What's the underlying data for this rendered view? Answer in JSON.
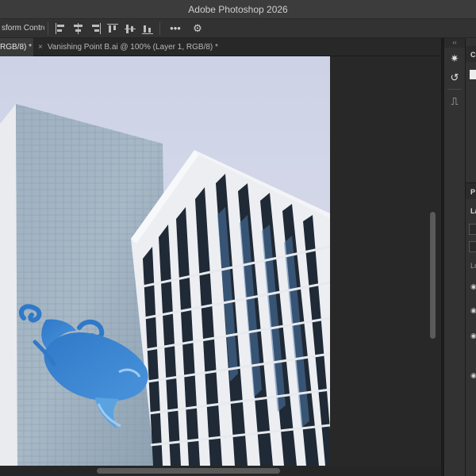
{
  "window": {
    "title": "Adobe Photoshop 2026"
  },
  "options_bar": {
    "transform_controls_label": "sform Controls",
    "align_icons": [
      "align-left-edges-icon",
      "align-horizontal-centers-icon",
      "align-right-edges-icon",
      "align-top-edges-icon",
      "align-vertical-centers-icon",
      "align-bottom-edges-icon"
    ],
    "more_label": "•••",
    "gear_icon": "gear-icon"
  },
  "tabs": [
    {
      "label": "RGB/8) *",
      "active": true
    },
    {
      "close": "×",
      "label": "Vanishing Point B.ai @ 100% (Layer 1, RGB/8) *",
      "active": false
    }
  ],
  "tools": [
    {
      "name": "magic-wand-icon",
      "glyph": "✷"
    },
    {
      "name": "history-brush-icon",
      "glyph": "↺"
    },
    {
      "name": "stamp-icon",
      "glyph": "⎍"
    }
  ],
  "right_dock": {
    "panel1_label": "C",
    "panel2_label": "P",
    "layers_label": "La",
    "kind_row_label": "Lo"
  },
  "colors": {
    "accent_blue": "#3a7bd5",
    "panel_bg": "#323232",
    "app_bg": "#1e1e1e"
  }
}
